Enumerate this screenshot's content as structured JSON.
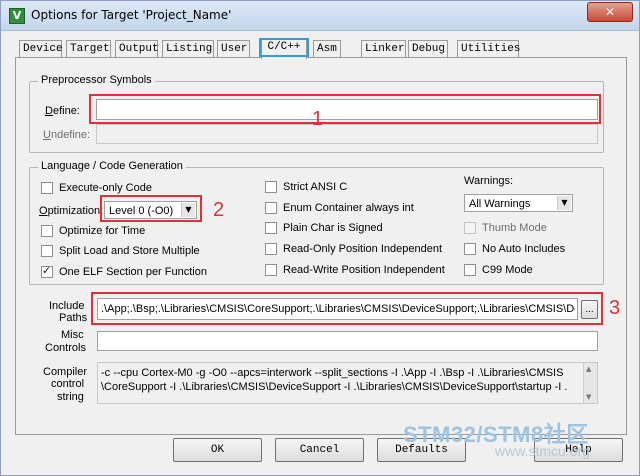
{
  "window": {
    "title": "Options for Target 'Project_Name'",
    "close_label": "✕"
  },
  "tabs": [
    {
      "label": "Device"
    },
    {
      "label": "Target"
    },
    {
      "label": "Output"
    },
    {
      "label": "Listing"
    },
    {
      "label": "User"
    },
    {
      "label": "C/C++"
    },
    {
      "label": "Asm"
    },
    {
      "label": "Linker"
    },
    {
      "label": "Debug"
    },
    {
      "label": "Utilities"
    }
  ],
  "preprocessor": {
    "legend": "Preprocessor Symbols",
    "define_label": "Define:",
    "define_value": "",
    "undefine_label": "Undefine:",
    "undefine_value": ""
  },
  "language": {
    "legend": "Language / Code Generation",
    "execute_only": "Execute-only Code",
    "optimization_label": "Optimization:",
    "optimization_value": "Level 0 (-O0)",
    "optimize_time": "Optimize for Time",
    "split_load": "Split Load and Store Multiple",
    "one_elf": "One ELF Section per Function",
    "strict_ansi": "Strict ANSI C",
    "enum_container": "Enum Container always int",
    "plain_char": "Plain Char is Signed",
    "ro_pi": "Read-Only Position Independent",
    "rw_pi": "Read-Write Position Independent",
    "warnings_label": "Warnings:",
    "warnings_value": "All Warnings",
    "thumb_mode": "Thumb Mode",
    "no_auto": "No Auto Includes",
    "c99": "C99 Mode"
  },
  "include": {
    "label_line1": "Include",
    "label_line2": "Paths",
    "value": ".\\App;.\\Bsp;.\\Libraries\\CMSIS\\CoreSupport;.\\Libraries\\CMSIS\\DeviceSupport;.\\Libraries\\CMSIS\\De",
    "browse_label": "..."
  },
  "misc": {
    "label_line1": "Misc",
    "label_line2": "Controls",
    "value": ""
  },
  "compiler": {
    "label_line1": "Compiler",
    "label_line2": "control",
    "label_line3": "string",
    "line1": "-c --cpu Cortex-M0 -g -O0 --apcs=interwork --split_sections -I .\\App -I .\\Bsp -I .\\Libraries\\CMSIS",
    "line2": "\\CoreSupport -I .\\Libraries\\CMSIS\\DeviceSupport -I .\\Libraries\\CMSIS\\DeviceSupport\\startup -I ."
  },
  "buttons": {
    "ok": "OK",
    "cancel": "Cancel",
    "defaults": "Defaults",
    "help": "Help"
  },
  "annotations": {
    "n1": "1",
    "n2": "2",
    "n3": "3"
  },
  "watermark": {
    "main": "STM32/STM8社区",
    "sub": "www.stmcu.org"
  }
}
